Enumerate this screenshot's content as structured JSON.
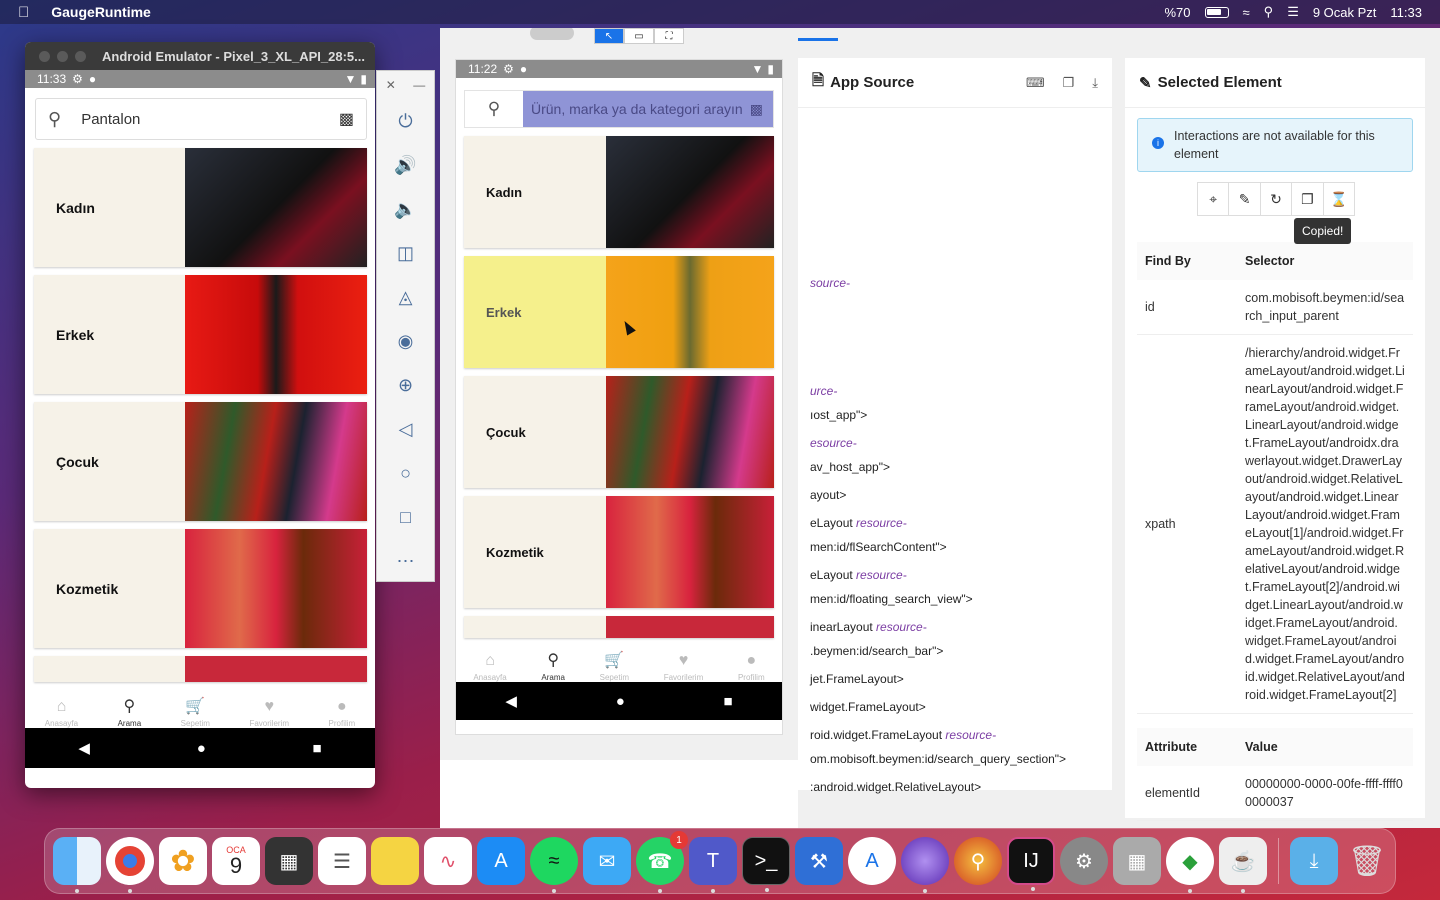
{
  "menubar": {
    "app": "GaugeRuntime",
    "battery": "%70",
    "date": "9 Ocak Pzt",
    "time": "11:33"
  },
  "emulator": {
    "title": "Android Emulator - Pixel_3_XL_API_28:5...",
    "status_time": "11:33",
    "search_value": "Pantalon",
    "categories": [
      "Kadın",
      "Erkek",
      "Çocuk",
      "Kozmetik"
    ],
    "nav": [
      "Anasayfa",
      "Arama",
      "Sepetim",
      "Favorilerim",
      "Profilim"
    ]
  },
  "inspector": {
    "status_time": "11:22",
    "search_placeholder": "Ürün, marka ya da kategori arayın",
    "categories": [
      "Kadın",
      "Erkek",
      "Çocuk",
      "Kozmetik"
    ],
    "nav": [
      "Anasayfa",
      "Arama",
      "Sepetim",
      "Favorilerim",
      "Profilim"
    ],
    "app_source": {
      "title": "App Source",
      "lines": [
        {
          "t": "",
          "r": "source-"
        },
        {
          "t": "",
          "r": "urce-"
        },
        {
          "t": "ıost_app\">",
          "r": ""
        },
        {
          "t": "",
          "r": "esource-"
        },
        {
          "t": "av_host_app\">",
          "r": ""
        },
        {
          "t": "ayout>",
          "r": ""
        },
        {
          "t": "eLayout ",
          "r": "resource-"
        },
        {
          "t": "men:id/flSearchContent\">",
          "r": ""
        },
        {
          "t": "eLayout ",
          "r": "resource-"
        },
        {
          "t": "men:id/floating_search_view\">",
          "r": ""
        },
        {
          "t": "inearLayout ",
          "r": "resource-"
        },
        {
          "t": ".beymen:id/search_bar\">",
          "r": ""
        },
        {
          "t": "jet.FrameLayout>",
          "r": ""
        },
        {
          "t": "widget.FrameLayout>",
          "r": ""
        },
        {
          "t": "roid.widget.FrameLayout ",
          "r": "resource-"
        },
        {
          "t": "om.mobisoft.beymen:id/search_query_section\">",
          "r": ""
        },
        {
          "t": ":android.widget.RelativeLayout>",
          "r": ""
        }
      ]
    },
    "selected": {
      "title": "Selected Element",
      "info": "Interactions are not available for this element",
      "tooltip": "Copied!",
      "find_headers": [
        "Find By",
        "Selector"
      ],
      "rows": [
        {
          "k": "id",
          "v": "com.mobisoft.beymen:id/search_input_parent"
        },
        {
          "k": "xpath",
          "v": "/hierarchy/android.widget.FrameLayout/android.widget.LinearLayout/android.widget.FrameLayout/android.widget.LinearLayout/android.widget.FrameLayout/androidx.drawerlayout.widget.DrawerLayout/android.widget.RelativeLayout/android.widget.LinearLayout/android.widget.FrameLayout[1]/android.widget.FrameLayout/android.widget.RelativeLayout/android.widget.FrameLayout[2]/android.widget.LinearLayout/android.widget.FrameLayout/android.widget.FrameLayout/android.widget.FrameLayout/android.widget.RelativeLayout/android.widget.FrameLayout[2]"
        }
      ],
      "attr_headers": [
        "Attribute",
        "Value"
      ],
      "attrs": [
        {
          "k": "elementId",
          "v": "00000000-0000-00fe-ffff-ffff00000037"
        }
      ]
    }
  },
  "dock": {
    "calendar_month": "OCA",
    "calendar_day": "9",
    "whatsapp_badge": "1"
  }
}
